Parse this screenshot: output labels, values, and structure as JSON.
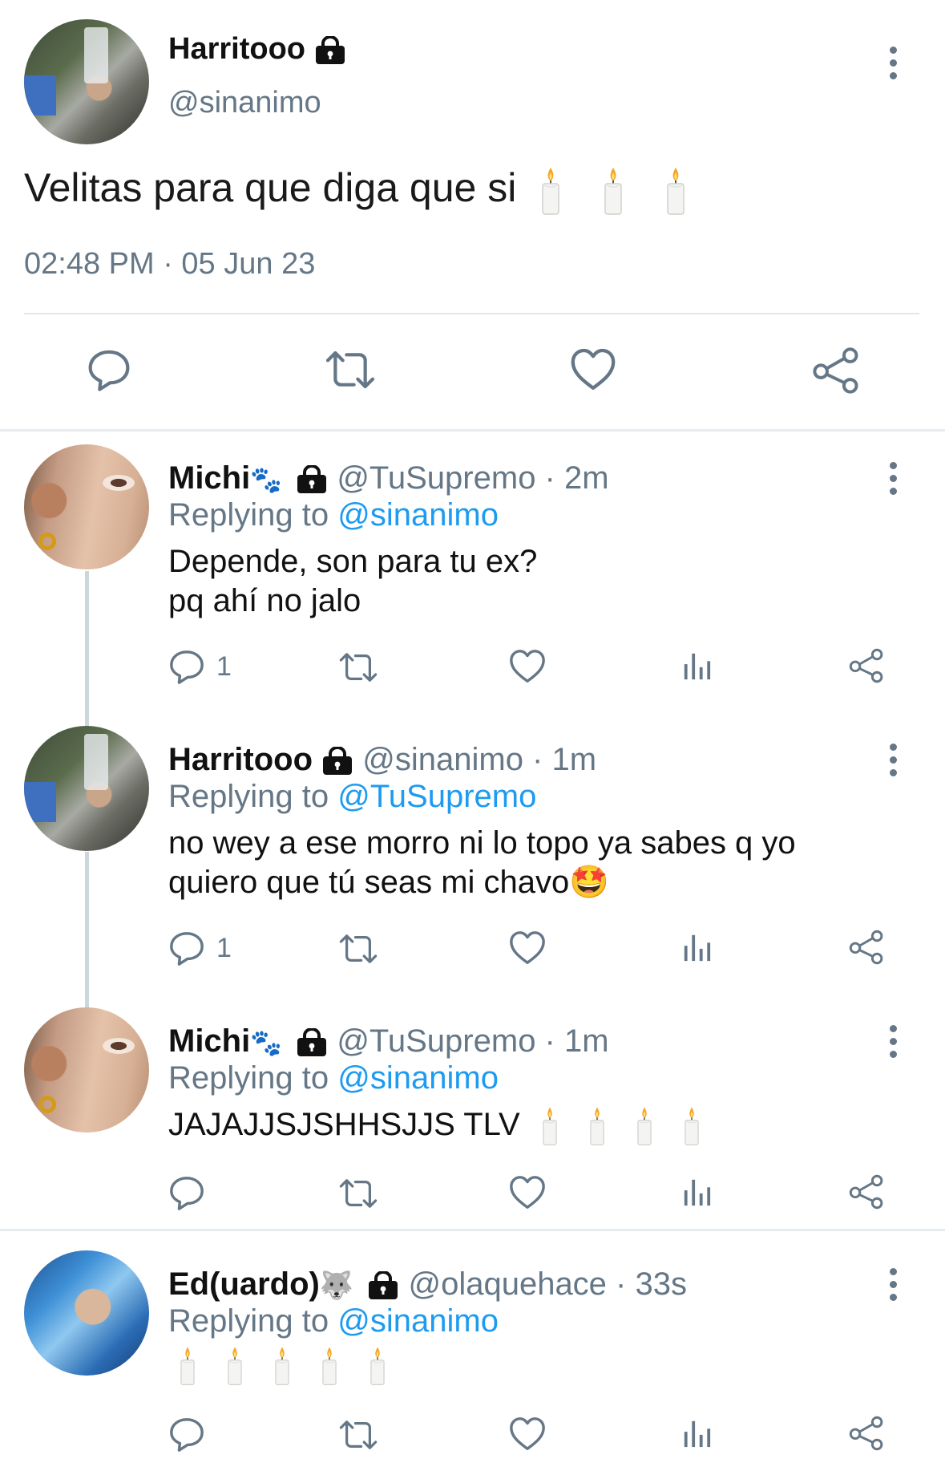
{
  "main": {
    "display_name": "Harritooo",
    "handle": "@sinanimo",
    "text": "Velitas para que diga que si",
    "candles": 3,
    "timestamp": "02:48 PM · 05 Jun 23"
  },
  "replies": [
    {
      "display_name": "Michi",
      "name_emoji": "🐾",
      "handle": "@TuSupremo",
      "age": "2m",
      "replying_prefix": "Replying to",
      "replying_to": "@sinanimo",
      "lines": [
        "Depende, son para tu ex?",
        "pq ahí no jalo"
      ],
      "reply_count": "1"
    },
    {
      "display_name": "Harritooo",
      "handle": "@sinanimo",
      "age": "1m",
      "replying_prefix": "Replying to",
      "replying_to": "@TuSupremo",
      "lines": [
        "no wey a ese morro ni lo topo ya sabes q yo",
        "quiero que tú seas mi chavo"
      ],
      "line_emoji": "🤩",
      "reply_count": "1"
    },
    {
      "display_name": "Michi",
      "name_emoji": "🐾",
      "handle": "@TuSupremo",
      "age": "1m",
      "replying_prefix": "Replying to",
      "replying_to": "@sinanimo",
      "lines": [
        "JAJAJJSJSHHSJJS TLV"
      ],
      "candles": 4
    },
    {
      "display_name": "Ed(uardo)",
      "name_emoji": "🐺",
      "handle": "@olaquehace",
      "age": "33s",
      "replying_prefix": "Replying to",
      "replying_to": "@sinanimo",
      "candles": 5
    }
  ],
  "icons": {
    "reply": "reply-icon",
    "retweet": "retweet-icon",
    "like": "heart-icon",
    "views": "views-icon",
    "share": "share-icon",
    "more": "more-vertical-icon",
    "lock": "lock-icon",
    "candle": "candle-emoji"
  },
  "colors": {
    "link": "#1d9bf0",
    "muted": "#657786",
    "divider": "#e1e8ed",
    "thread_line": "#ccd6dd"
  }
}
